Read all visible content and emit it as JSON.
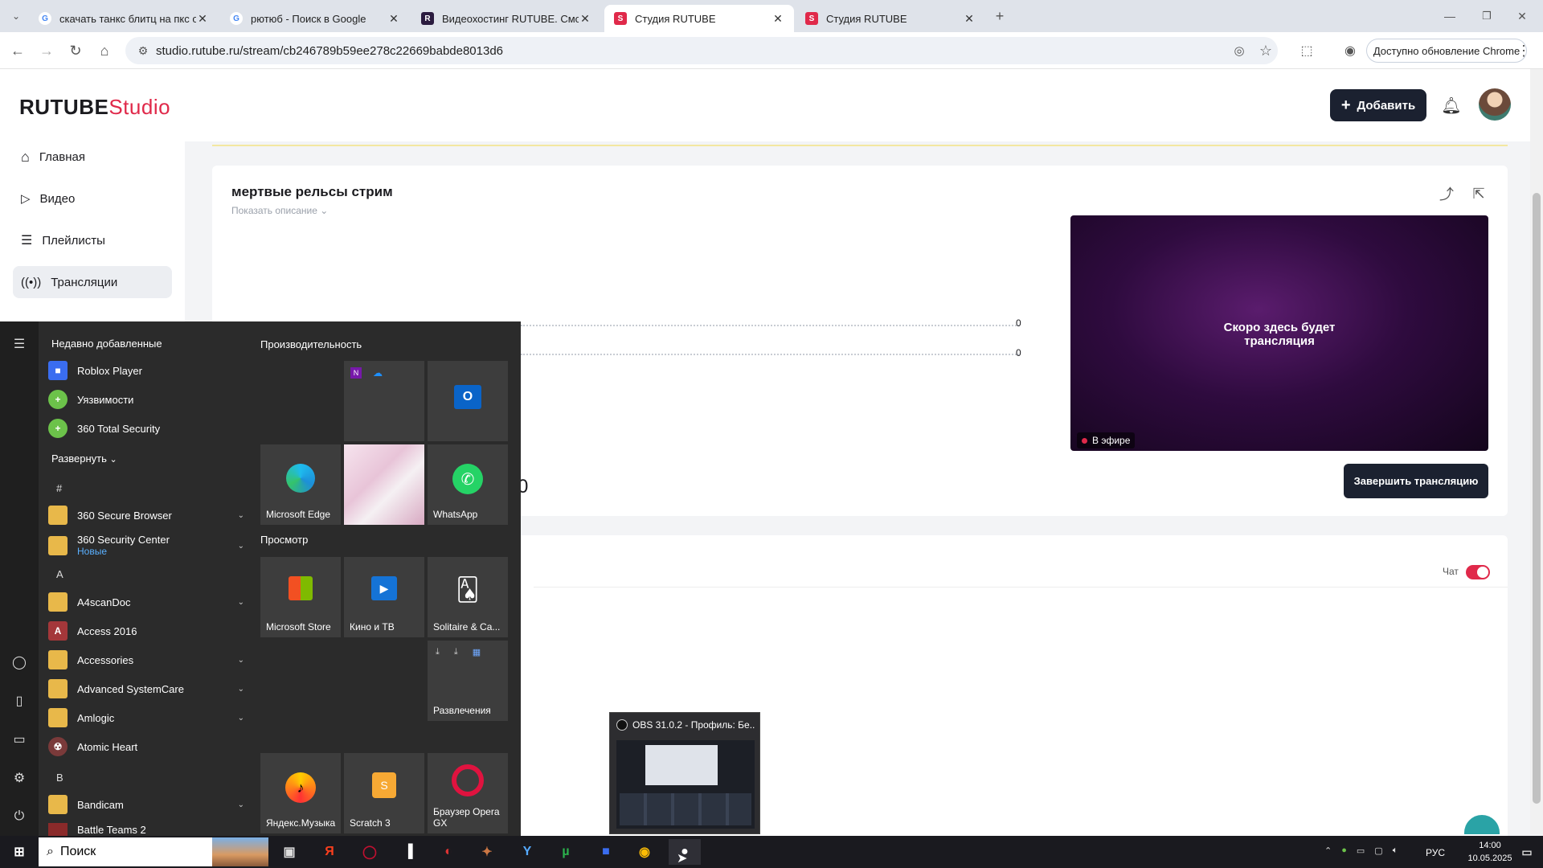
{
  "tabs": [
    {
      "title": "скачать танкс блитц на пкс оф",
      "fav": "G",
      "favColor": "#4285f4"
    },
    {
      "title": "рютюб - Поиск в Google",
      "fav": "G",
      "favColor": "#4285f4"
    },
    {
      "title": "Видеохостинг RUTUBE. Смотри",
      "fav": "R",
      "favColor": "#2b1b3f"
    },
    {
      "title": "Студия RUTUBE",
      "fav": "S",
      "favColor": "#e0294a"
    },
    {
      "title": "Студия RUTUBE",
      "fav": "S",
      "favColor": "#e0294a"
    }
  ],
  "address": {
    "url": "studio.rutube.ru/stream/cb246789b59ee278c22669babde8013d6"
  },
  "browser": {
    "update_label": "Доступно обновление Chrome"
  },
  "header": {
    "logo_main": "RUTUBE",
    "logo_sub": "Studio",
    "add_label": "Добавить"
  },
  "sidebar": {
    "items": [
      "Главная",
      "Видео",
      "Плейлисты",
      "Трансляции"
    ]
  },
  "stream": {
    "title": "мертвые рельсы стрим",
    "show_desc": "Показать описание",
    "stat_a": "0",
    "stat_b": "0",
    "partial_value": "0",
    "preview_text_1": "Скоро здесь будет",
    "preview_text_2": "трансляция",
    "live_label": "В эфире",
    "end_label": "Завершить трансляцию"
  },
  "chat": {
    "label": "Чат"
  },
  "startmenu": {
    "recent_header": "Недавно добавленные",
    "recent": [
      "Roblox Player",
      "Уязвимости",
      "360 Total Security"
    ],
    "expand": "Развернуть",
    "hash": "#",
    "apps_hash": [
      {
        "name": "360 Secure Browser"
      },
      {
        "name": "360 Security Center",
        "sub": "Новые"
      }
    ],
    "letter_a": "A",
    "apps_a": [
      "A4scanDoc",
      "Access 2016",
      "Accessories",
      "Advanced SystemCare",
      "Amlogic",
      "Atomic Heart"
    ],
    "letter_b": "B",
    "apps_b": [
      "Bandicam",
      "Battle Teams 2"
    ],
    "prod_header": "Производительность",
    "view_header": "Просмотр",
    "tiles": {
      "edge": "Microsoft Edge",
      "whatsapp": "WhatsApp",
      "store": "Microsoft Store",
      "kino": "Кино и ТВ",
      "solitaire": "Solitaire & Ca...",
      "fun": "Развлечения",
      "ymusic": "Яндекс.Музыка",
      "scratch": "Scratch 3",
      "opera": "Браузер Opera GX"
    }
  },
  "obs_thumb": {
    "title": "OBS 31.0.2 - Профиль: Бе..."
  },
  "taskbar": {
    "search": "Поиск",
    "lang": "РУС",
    "time": "14:00",
    "date": "10.05.2025"
  }
}
